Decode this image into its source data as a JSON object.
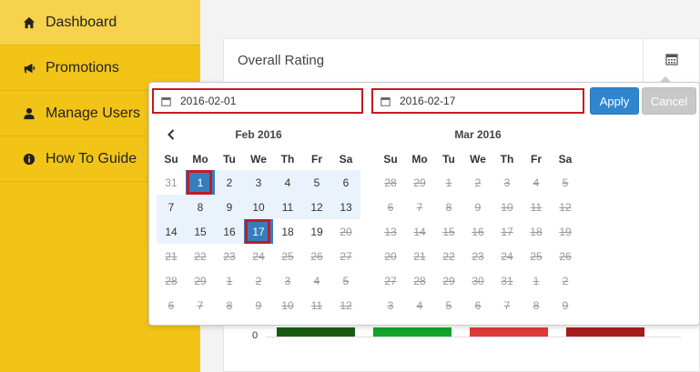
{
  "sidebar": {
    "items": [
      {
        "label": "Dashboard",
        "icon": "home-icon",
        "active": true
      },
      {
        "label": "Promotions",
        "icon": "bullhorn-icon",
        "active": false
      },
      {
        "label": "Manage Users",
        "icon": "user-icon",
        "active": false
      },
      {
        "label": "How To Guide",
        "icon": "info-circle-icon",
        "active": false
      }
    ]
  },
  "panel": {
    "title": "Overall Rating",
    "calendar_icon": "calendar-icon"
  },
  "chart": {
    "axis_zero_label": "0",
    "bar_colors": [
      "#1a5c16",
      "#14a329",
      "#e03a3a",
      "#a61c1c"
    ]
  },
  "picker": {
    "start_date": "2016-02-01",
    "end_date": "2016-02-17",
    "apply_label": "Apply",
    "cancel_label": "Cancel",
    "weekdays": [
      "Su",
      "Mo",
      "Tu",
      "We",
      "Th",
      "Fr",
      "Sa"
    ],
    "months": [
      {
        "title": "Feb 2016",
        "has_prev": true,
        "weeks": [
          [
            {
              "d": "31",
              "s": "off"
            },
            {
              "d": "1",
              "s": "sel"
            },
            {
              "d": "2",
              "s": "inrange"
            },
            {
              "d": "3",
              "s": "inrange"
            },
            {
              "d": "4",
              "s": "inrange"
            },
            {
              "d": "5",
              "s": "inrange"
            },
            {
              "d": "6",
              "s": "inrange"
            }
          ],
          [
            {
              "d": "7",
              "s": "inrange"
            },
            {
              "d": "8",
              "s": "inrange"
            },
            {
              "d": "9",
              "s": "inrange"
            },
            {
              "d": "10",
              "s": "inrange"
            },
            {
              "d": "11",
              "s": "inrange"
            },
            {
              "d": "12",
              "s": "inrange"
            },
            {
              "d": "13",
              "s": "inrange"
            }
          ],
          [
            {
              "d": "14",
              "s": "inrange"
            },
            {
              "d": "15",
              "s": "inrange"
            },
            {
              "d": "16",
              "s": "inrange"
            },
            {
              "d": "17",
              "s": "sel"
            },
            {
              "d": "18",
              "s": ""
            },
            {
              "d": "19",
              "s": ""
            },
            {
              "d": "20",
              "s": "dis"
            }
          ],
          [
            {
              "d": "21",
              "s": "dis"
            },
            {
              "d": "22",
              "s": "dis"
            },
            {
              "d": "23",
              "s": "dis"
            },
            {
              "d": "24",
              "s": "dis"
            },
            {
              "d": "25",
              "s": "dis"
            },
            {
              "d": "26",
              "s": "dis"
            },
            {
              "d": "27",
              "s": "dis"
            }
          ],
          [
            {
              "d": "28",
              "s": "dis"
            },
            {
              "d": "29",
              "s": "dis"
            },
            {
              "d": "1",
              "s": "dis"
            },
            {
              "d": "2",
              "s": "dis"
            },
            {
              "d": "3",
              "s": "dis"
            },
            {
              "d": "4",
              "s": "dis"
            },
            {
              "d": "5",
              "s": "dis"
            }
          ],
          [
            {
              "d": "6",
              "s": "dis"
            },
            {
              "d": "7",
              "s": "dis"
            },
            {
              "d": "8",
              "s": "dis"
            },
            {
              "d": "9",
              "s": "dis"
            },
            {
              "d": "10",
              "s": "dis"
            },
            {
              "d": "11",
              "s": "dis"
            },
            {
              "d": "12",
              "s": "dis"
            }
          ]
        ]
      },
      {
        "title": "Mar 2016",
        "has_prev": false,
        "weeks": [
          [
            {
              "d": "28",
              "s": "dis"
            },
            {
              "d": "29",
              "s": "dis"
            },
            {
              "d": "1",
              "s": "dis"
            },
            {
              "d": "2",
              "s": "dis"
            },
            {
              "d": "3",
              "s": "dis"
            },
            {
              "d": "4",
              "s": "dis"
            },
            {
              "d": "5",
              "s": "dis"
            }
          ],
          [
            {
              "d": "6",
              "s": "dis"
            },
            {
              "d": "7",
              "s": "dis"
            },
            {
              "d": "8",
              "s": "dis"
            },
            {
              "d": "9",
              "s": "dis"
            },
            {
              "d": "10",
              "s": "dis"
            },
            {
              "d": "11",
              "s": "dis"
            },
            {
              "d": "12",
              "s": "dis"
            }
          ],
          [
            {
              "d": "13",
              "s": "dis"
            },
            {
              "d": "14",
              "s": "dis"
            },
            {
              "d": "15",
              "s": "dis"
            },
            {
              "d": "16",
              "s": "dis"
            },
            {
              "d": "17",
              "s": "dis"
            },
            {
              "d": "18",
              "s": "dis"
            },
            {
              "d": "19",
              "s": "dis"
            }
          ],
          [
            {
              "d": "20",
              "s": "dis"
            },
            {
              "d": "21",
              "s": "dis"
            },
            {
              "d": "22",
              "s": "dis"
            },
            {
              "d": "23",
              "s": "dis"
            },
            {
              "d": "24",
              "s": "dis"
            },
            {
              "d": "25",
              "s": "dis"
            },
            {
              "d": "26",
              "s": "dis"
            }
          ],
          [
            {
              "d": "27",
              "s": "dis"
            },
            {
              "d": "28",
              "s": "dis"
            },
            {
              "d": "29",
              "s": "dis"
            },
            {
              "d": "30",
              "s": "dis"
            },
            {
              "d": "31",
              "s": "dis"
            },
            {
              "d": "1",
              "s": "dis"
            },
            {
              "d": "2",
              "s": "dis"
            }
          ],
          [
            {
              "d": "3",
              "s": "dis"
            },
            {
              "d": "4",
              "s": "dis"
            },
            {
              "d": "5",
              "s": "dis"
            },
            {
              "d": "6",
              "s": "dis"
            },
            {
              "d": "7",
              "s": "dis"
            },
            {
              "d": "8",
              "s": "dis"
            },
            {
              "d": "9",
              "s": "dis"
            }
          ]
        ]
      }
    ]
  }
}
